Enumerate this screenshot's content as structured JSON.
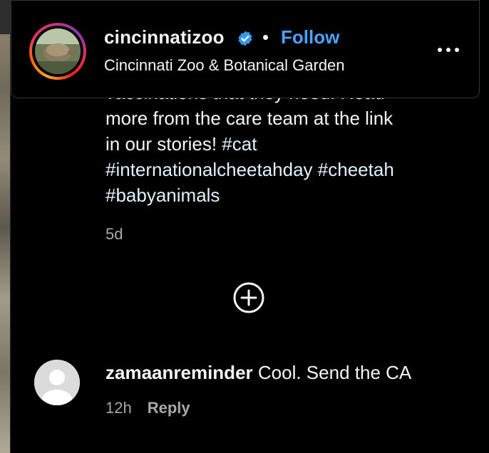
{
  "header": {
    "username": "cincinnatizoo",
    "separator": "•",
    "follow_label": "Follow",
    "full_name": "Cincinnati Zoo & Botanical Garden",
    "accent_color": "#4aa3ff"
  },
  "caption": {
    "partial_line": "vaccinations that they need. Read",
    "line2": "more from the care team at the link",
    "line3_text": "in our stories! ",
    "hashtags": [
      "#cat",
      "#internationalcheetahday",
      "#cheetah",
      "#babyanimals"
    ],
    "time_ago": "5d"
  },
  "comment": {
    "username": "zamaanreminder",
    "text": "Cool. Send the CA",
    "time_ago": "12h",
    "reply_label": "Reply"
  },
  "icons": {
    "verified": "verified-badge-icon",
    "more": "more-options-icon",
    "load_more": "plus-circle-icon"
  }
}
